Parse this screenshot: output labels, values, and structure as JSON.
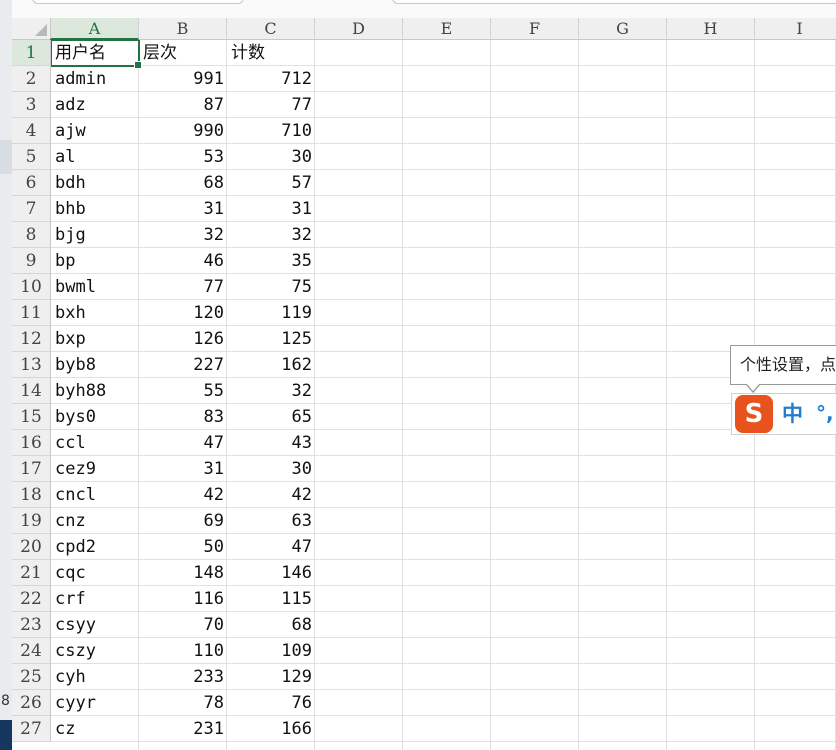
{
  "columns": [
    "A",
    "B",
    "C",
    "D",
    "E",
    "F",
    "G",
    "H",
    "I"
  ],
  "selected_cell": "A1",
  "rows": [
    {
      "n": "1",
      "a": "用户名",
      "b": "层次",
      "c": "计数"
    },
    {
      "n": "2",
      "a": "admin",
      "b": "991",
      "c": "712"
    },
    {
      "n": "3",
      "a": "adz",
      "b": "87",
      "c": "77"
    },
    {
      "n": "4",
      "a": "ajw",
      "b": "990",
      "c": "710"
    },
    {
      "n": "5",
      "a": "al",
      "b": "53",
      "c": "30"
    },
    {
      "n": "6",
      "a": "bdh",
      "b": "68",
      "c": "57"
    },
    {
      "n": "7",
      "a": "bhb",
      "b": "31",
      "c": "31"
    },
    {
      "n": "8",
      "a": "bjg",
      "b": "32",
      "c": "32"
    },
    {
      "n": "9",
      "a": "bp",
      "b": "46",
      "c": "35"
    },
    {
      "n": "10",
      "a": "bwml",
      "b": "77",
      "c": "75"
    },
    {
      "n": "11",
      "a": "bxh",
      "b": "120",
      "c": "119"
    },
    {
      "n": "12",
      "a": "bxp",
      "b": "126",
      "c": "125"
    },
    {
      "n": "13",
      "a": "byb8",
      "b": "227",
      "c": "162"
    },
    {
      "n": "14",
      "a": "byh88",
      "b": "55",
      "c": "32"
    },
    {
      "n": "15",
      "a": "bys0",
      "b": "83",
      "c": "65"
    },
    {
      "n": "16",
      "a": "ccl",
      "b": "47",
      "c": "43"
    },
    {
      "n": "17",
      "a": "cez9",
      "b": "31",
      "c": "30"
    },
    {
      "n": "18",
      "a": "cncl",
      "b": "42",
      "c": "42"
    },
    {
      "n": "19",
      "a": "cnz",
      "b": "69",
      "c": "63"
    },
    {
      "n": "20",
      "a": "cpd2",
      "b": "50",
      "c": "47"
    },
    {
      "n": "21",
      "a": "cqc",
      "b": "148",
      "c": "146"
    },
    {
      "n": "22",
      "a": "crf",
      "b": "116",
      "c": "115"
    },
    {
      "n": "23",
      "a": "csyy",
      "b": "70",
      "c": "68"
    },
    {
      "n": "24",
      "a": "cszy",
      "b": "110",
      "c": "109"
    },
    {
      "n": "25",
      "a": "cyh",
      "b": "233",
      "c": "129"
    },
    {
      "n": "26",
      "a": "cyyr",
      "b": "78",
      "c": "76"
    },
    {
      "n": "27",
      "a": "cz",
      "b": "231",
      "c": "166"
    }
  ],
  "ime": {
    "tooltip": "个性设置，点",
    "logo": "S",
    "mode": "中",
    "punct": "°,"
  },
  "left_strip": {
    "g1": "8"
  },
  "colors": {
    "selection": "#217346",
    "ime_logo": "#e8531d",
    "ime_text": "#1f7ed3"
  }
}
